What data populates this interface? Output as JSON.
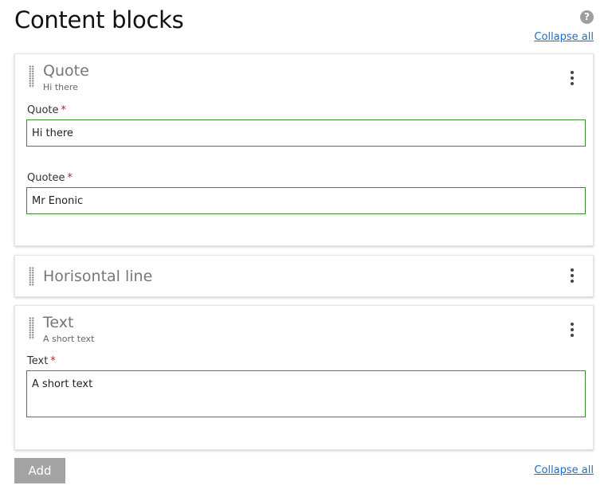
{
  "header": {
    "title": "Content blocks",
    "help_icon_glyph": "?",
    "collapse_all_label": "Collapse all"
  },
  "blocks": [
    {
      "title": "Quote",
      "subtitle": "Hi there",
      "fields": [
        {
          "label": "Quote",
          "required_mark": "*",
          "value": "Hi there"
        },
        {
          "label": "Quotee",
          "required_mark": "*",
          "value": "Mr Enonic"
        }
      ]
    },
    {
      "title": "Horisontal line"
    },
    {
      "title": "Text",
      "subtitle": "A short text",
      "fields": [
        {
          "label": "Text",
          "required_mark": "*",
          "value": "A short text"
        }
      ]
    }
  ],
  "footer": {
    "add_label": "Add",
    "collapse_all_label": "Collapse all"
  },
  "colors": {
    "input_border": "#3c8c30",
    "required_mark": "#a52a2a",
    "link": "#1a6fc9",
    "add_button_bg": "#a3a3a3"
  },
  "icons": [
    "help-icon",
    "drag-handle-icon",
    "more-vertical-icon"
  ]
}
